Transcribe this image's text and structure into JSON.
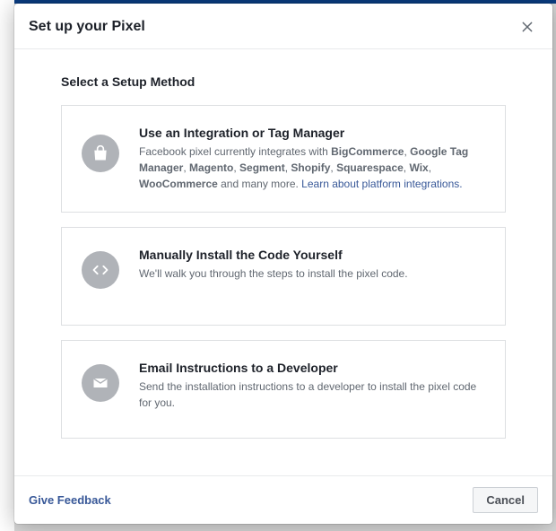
{
  "modal": {
    "title": "Set up your Pixel",
    "section_heading": "Select a Setup Method",
    "options": [
      {
        "title": "Use an Integration or Tag Manager",
        "desc_prefix": "Facebook pixel currently integrates with ",
        "integrations": [
          "BigCommerce",
          "Google Tag Manager",
          "Magento",
          "Segment",
          "Shopify",
          "Squarespace",
          "Wix",
          "WooCommerce"
        ],
        "desc_suffix": " and many more. ",
        "link_text": "Learn about platform integrations.",
        "icon": "shopping-bag-icon"
      },
      {
        "title": "Manually Install the Code Yourself",
        "desc": "We'll walk you through the steps to install the pixel code.",
        "icon": "code-icon"
      },
      {
        "title": "Email Instructions to a Developer",
        "desc": "Send the installation instructions to a developer to install the pixel code for you.",
        "icon": "mail-icon"
      }
    ],
    "footer": {
      "feedback": "Give Feedback",
      "cancel": "Cancel"
    }
  }
}
